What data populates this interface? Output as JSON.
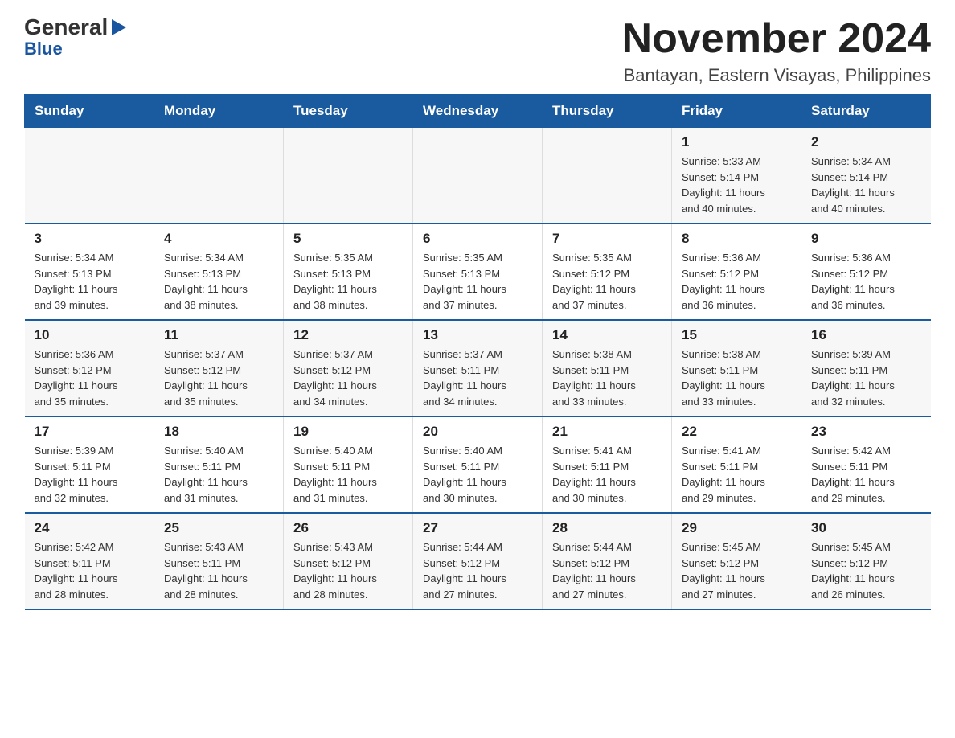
{
  "header": {
    "logo_general": "General",
    "logo_blue": "Blue",
    "main_title": "November 2024",
    "subtitle": "Bantayan, Eastern Visayas, Philippines"
  },
  "calendar": {
    "days_of_week": [
      "Sunday",
      "Monday",
      "Tuesday",
      "Wednesday",
      "Thursday",
      "Friday",
      "Saturday"
    ],
    "weeks": [
      [
        {
          "day": "",
          "info": ""
        },
        {
          "day": "",
          "info": ""
        },
        {
          "day": "",
          "info": ""
        },
        {
          "day": "",
          "info": ""
        },
        {
          "day": "",
          "info": ""
        },
        {
          "day": "1",
          "info": "Sunrise: 5:33 AM\nSunset: 5:14 PM\nDaylight: 11 hours\nand 40 minutes."
        },
        {
          "day": "2",
          "info": "Sunrise: 5:34 AM\nSunset: 5:14 PM\nDaylight: 11 hours\nand 40 minutes."
        }
      ],
      [
        {
          "day": "3",
          "info": "Sunrise: 5:34 AM\nSunset: 5:13 PM\nDaylight: 11 hours\nand 39 minutes."
        },
        {
          "day": "4",
          "info": "Sunrise: 5:34 AM\nSunset: 5:13 PM\nDaylight: 11 hours\nand 38 minutes."
        },
        {
          "day": "5",
          "info": "Sunrise: 5:35 AM\nSunset: 5:13 PM\nDaylight: 11 hours\nand 38 minutes."
        },
        {
          "day": "6",
          "info": "Sunrise: 5:35 AM\nSunset: 5:13 PM\nDaylight: 11 hours\nand 37 minutes."
        },
        {
          "day": "7",
          "info": "Sunrise: 5:35 AM\nSunset: 5:12 PM\nDaylight: 11 hours\nand 37 minutes."
        },
        {
          "day": "8",
          "info": "Sunrise: 5:36 AM\nSunset: 5:12 PM\nDaylight: 11 hours\nand 36 minutes."
        },
        {
          "day": "9",
          "info": "Sunrise: 5:36 AM\nSunset: 5:12 PM\nDaylight: 11 hours\nand 36 minutes."
        }
      ],
      [
        {
          "day": "10",
          "info": "Sunrise: 5:36 AM\nSunset: 5:12 PM\nDaylight: 11 hours\nand 35 minutes."
        },
        {
          "day": "11",
          "info": "Sunrise: 5:37 AM\nSunset: 5:12 PM\nDaylight: 11 hours\nand 35 minutes."
        },
        {
          "day": "12",
          "info": "Sunrise: 5:37 AM\nSunset: 5:12 PM\nDaylight: 11 hours\nand 34 minutes."
        },
        {
          "day": "13",
          "info": "Sunrise: 5:37 AM\nSunset: 5:11 PM\nDaylight: 11 hours\nand 34 minutes."
        },
        {
          "day": "14",
          "info": "Sunrise: 5:38 AM\nSunset: 5:11 PM\nDaylight: 11 hours\nand 33 minutes."
        },
        {
          "day": "15",
          "info": "Sunrise: 5:38 AM\nSunset: 5:11 PM\nDaylight: 11 hours\nand 33 minutes."
        },
        {
          "day": "16",
          "info": "Sunrise: 5:39 AM\nSunset: 5:11 PM\nDaylight: 11 hours\nand 32 minutes."
        }
      ],
      [
        {
          "day": "17",
          "info": "Sunrise: 5:39 AM\nSunset: 5:11 PM\nDaylight: 11 hours\nand 32 minutes."
        },
        {
          "day": "18",
          "info": "Sunrise: 5:40 AM\nSunset: 5:11 PM\nDaylight: 11 hours\nand 31 minutes."
        },
        {
          "day": "19",
          "info": "Sunrise: 5:40 AM\nSunset: 5:11 PM\nDaylight: 11 hours\nand 31 minutes."
        },
        {
          "day": "20",
          "info": "Sunrise: 5:40 AM\nSunset: 5:11 PM\nDaylight: 11 hours\nand 30 minutes."
        },
        {
          "day": "21",
          "info": "Sunrise: 5:41 AM\nSunset: 5:11 PM\nDaylight: 11 hours\nand 30 minutes."
        },
        {
          "day": "22",
          "info": "Sunrise: 5:41 AM\nSunset: 5:11 PM\nDaylight: 11 hours\nand 29 minutes."
        },
        {
          "day": "23",
          "info": "Sunrise: 5:42 AM\nSunset: 5:11 PM\nDaylight: 11 hours\nand 29 minutes."
        }
      ],
      [
        {
          "day": "24",
          "info": "Sunrise: 5:42 AM\nSunset: 5:11 PM\nDaylight: 11 hours\nand 28 minutes."
        },
        {
          "day": "25",
          "info": "Sunrise: 5:43 AM\nSunset: 5:11 PM\nDaylight: 11 hours\nand 28 minutes."
        },
        {
          "day": "26",
          "info": "Sunrise: 5:43 AM\nSunset: 5:12 PM\nDaylight: 11 hours\nand 28 minutes."
        },
        {
          "day": "27",
          "info": "Sunrise: 5:44 AM\nSunset: 5:12 PM\nDaylight: 11 hours\nand 27 minutes."
        },
        {
          "day": "28",
          "info": "Sunrise: 5:44 AM\nSunset: 5:12 PM\nDaylight: 11 hours\nand 27 minutes."
        },
        {
          "day": "29",
          "info": "Sunrise: 5:45 AM\nSunset: 5:12 PM\nDaylight: 11 hours\nand 27 minutes."
        },
        {
          "day": "30",
          "info": "Sunrise: 5:45 AM\nSunset: 5:12 PM\nDaylight: 11 hours\nand 26 minutes."
        }
      ]
    ]
  }
}
